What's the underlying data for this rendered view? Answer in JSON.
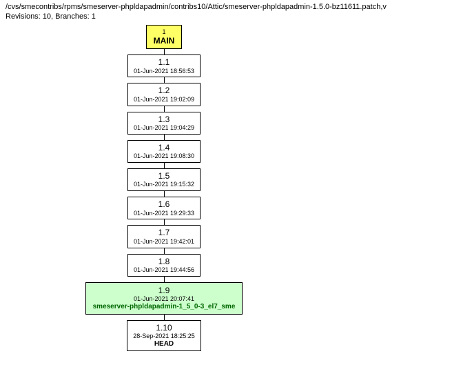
{
  "header": {
    "path": "/cvs/smecontribs/rpms/smeserver-phpldapadmin/contribs10/Attic/smeserver-phpldapadmin-1.5.0-bz11611.patch,v",
    "meta": "Revisions: 10, Branches: 1"
  },
  "main": {
    "small": "1",
    "label": "MAIN"
  },
  "revisions": [
    {
      "version": "1.1",
      "timestamp": "01-Jun-2021 18:56:53"
    },
    {
      "version": "1.2",
      "timestamp": "01-Jun-2021 19:02:09"
    },
    {
      "version": "1.3",
      "timestamp": "01-Jun-2021 19:04:29"
    },
    {
      "version": "1.4",
      "timestamp": "01-Jun-2021 19:08:30"
    },
    {
      "version": "1.5",
      "timestamp": "01-Jun-2021 19:15:32"
    },
    {
      "version": "1.6",
      "timestamp": "01-Jun-2021 19:29:33"
    },
    {
      "version": "1.7",
      "timestamp": "01-Jun-2021 19:42:01"
    },
    {
      "version": "1.8",
      "timestamp": "01-Jun-2021 19:44:56"
    }
  ],
  "tagged": {
    "version": "1.9",
    "timestamp": "01-Jun-2021 20:07:41",
    "tag": "smeserver-phpldapadmin-1_5_0-3_el7_sme"
  },
  "head": {
    "version": "1.10",
    "timestamp": "28-Sep-2021 18:25:25",
    "label": "HEAD"
  }
}
